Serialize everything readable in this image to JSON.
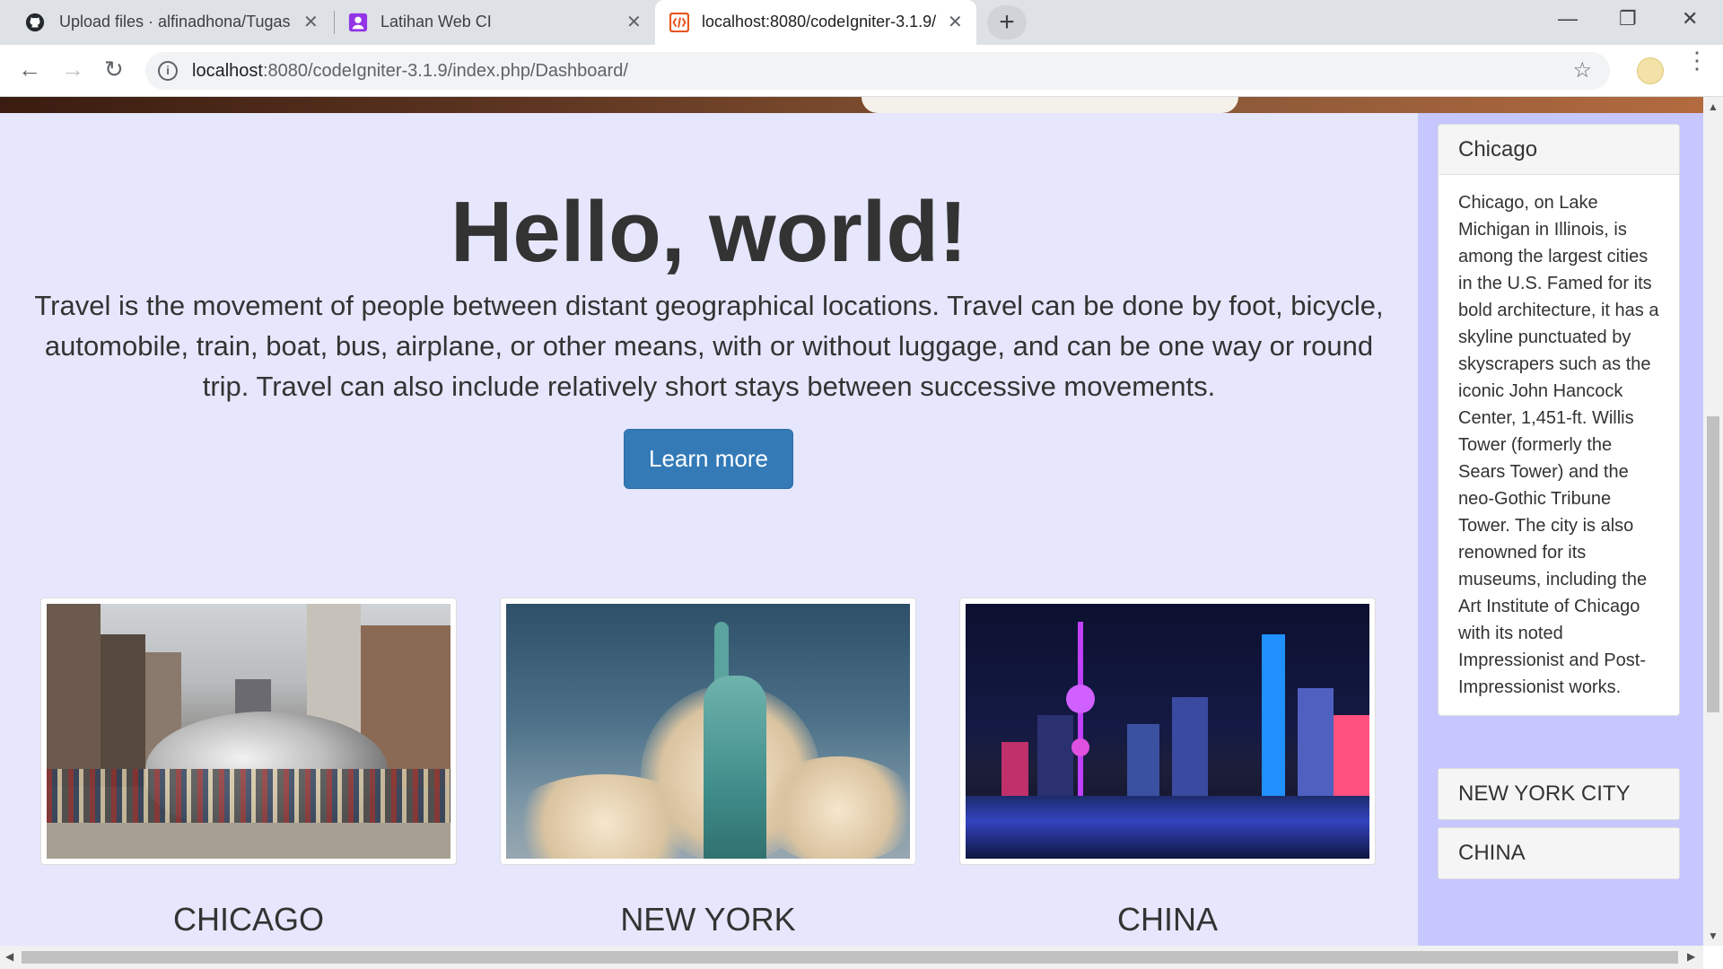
{
  "browser": {
    "tabs": [
      {
        "title": "Upload files · alfinadhona/Tugas",
        "icon": "github-icon"
      },
      {
        "title": "Latihan Web CI",
        "icon": "profile-icon"
      },
      {
        "title": "localhost:8080/codeIgniter-3.1.9/",
        "icon": "codeigniter-icon",
        "active": true
      }
    ],
    "new_tab_label": "+",
    "window_controls": {
      "minimize": "—",
      "restore": "❐",
      "close": "✕"
    },
    "nav": {
      "back": "←",
      "forward": "→",
      "reload": "↻"
    },
    "url_host": "localhost",
    "url_rest": ":8080/codeIgniter-3.1.9/index.php/Dashboard/",
    "star": "☆",
    "menu": "⋮"
  },
  "jumbotron": {
    "title": "Hello, world!",
    "lead": "Travel is the movement of people between distant geographical locations. Travel can be done by foot, bicycle, automobile, train, boat, bus, airplane, or other means, with or without luggage, and can be one way or round trip. Travel can also include relatively short stays between successive movements.",
    "button": "Learn more",
    "button_color": "#337ab7"
  },
  "gallery": [
    {
      "caption": "CHICAGO"
    },
    {
      "caption": "NEW YORK"
    },
    {
      "caption": "CHINA"
    }
  ],
  "sidebar": {
    "panels": [
      {
        "heading": "Chicago",
        "body": "Chicago, on Lake Michigan in Illinois, is among the largest cities in the U.S. Famed for its bold architecture, it has a skyline punctuated by skyscrapers such as the iconic John Hancock Center, 1,451-ft. Willis Tower (formerly the Sears Tower) and the neo-Gothic Tribune Tower. The city is also renowned for its museums, including the Art Institute of Chicago with its noted Impressionist and Post-Impressionist works."
      },
      {
        "heading": "NEW YORK CITY"
      },
      {
        "heading": "CHINA"
      }
    ],
    "background": "#c7c7ff"
  },
  "colors": {
    "page_background": "#e6e6fd",
    "text": "#333333"
  }
}
